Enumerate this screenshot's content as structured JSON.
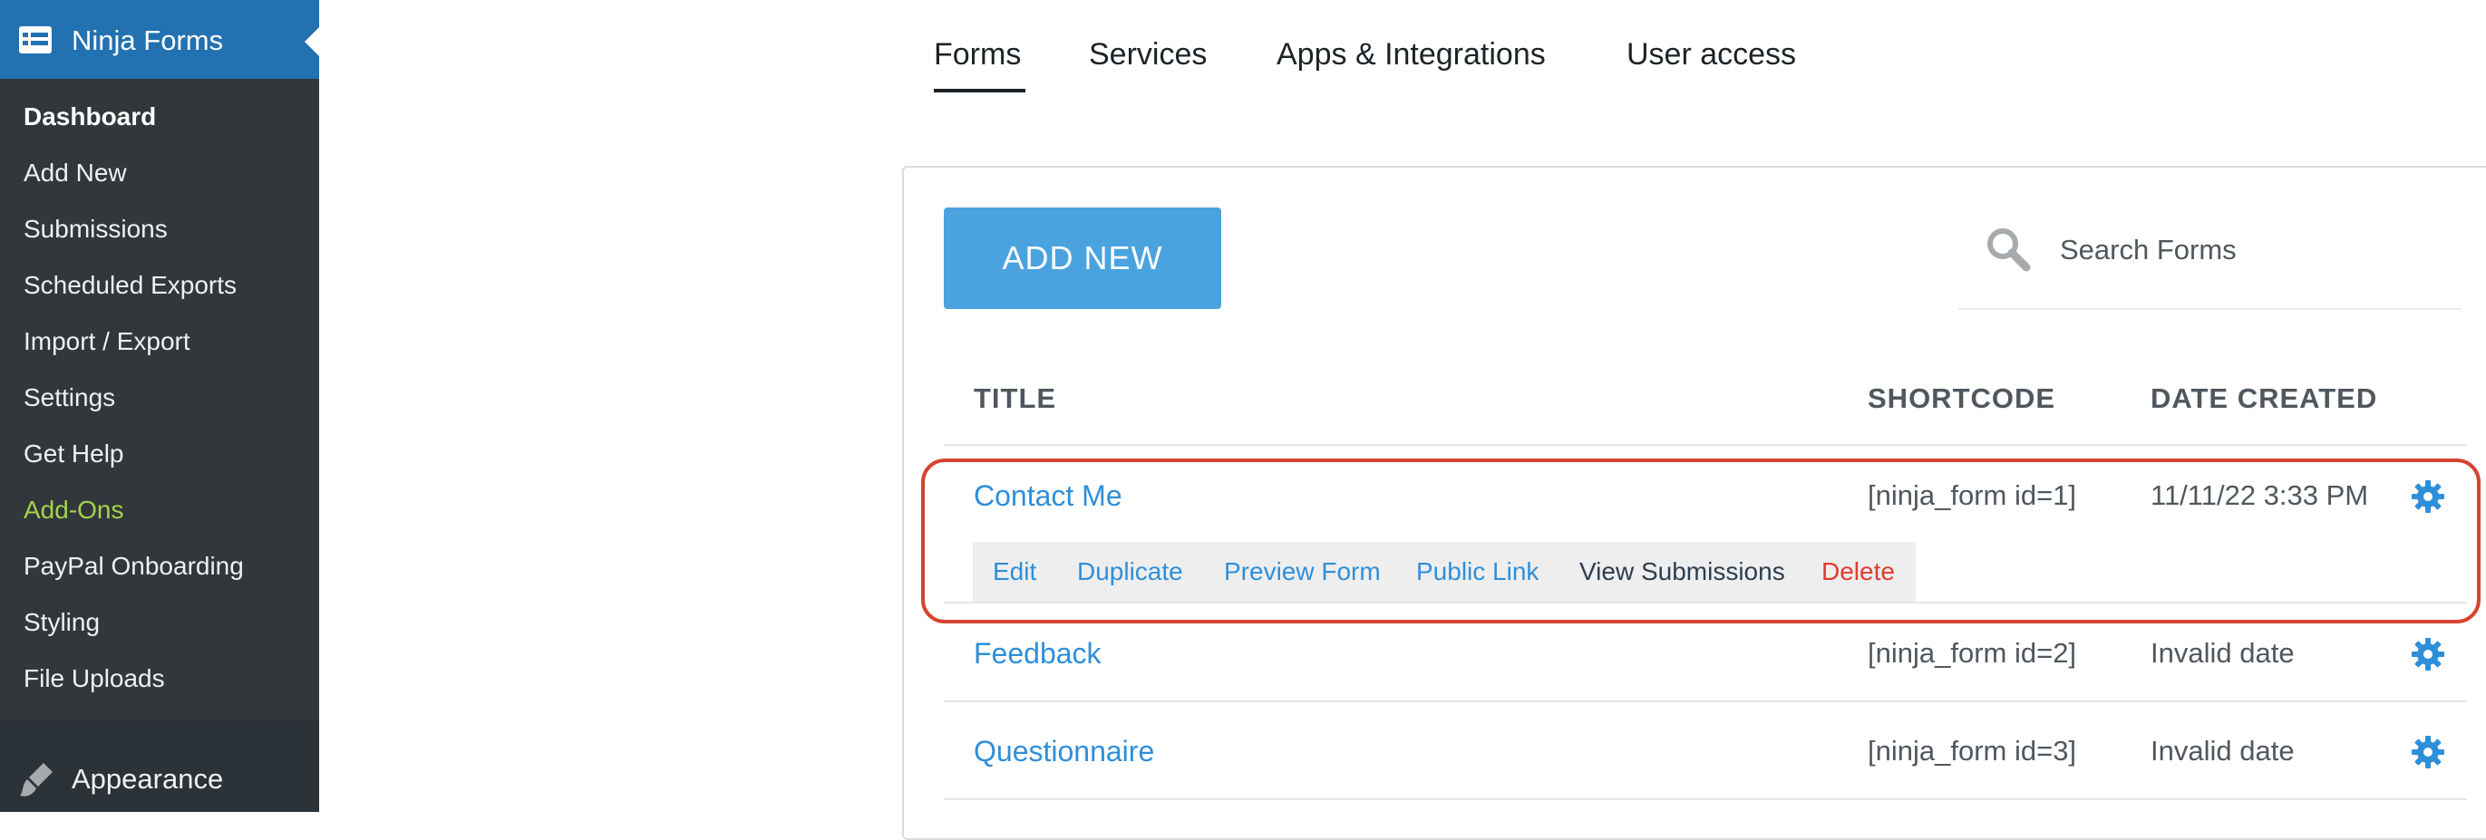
{
  "sidebar": {
    "header_label": "Ninja Forms",
    "header_icon": "ninja-forms-icon",
    "items": [
      {
        "label": "Dashboard",
        "current": true
      },
      {
        "label": "Add New"
      },
      {
        "label": "Submissions"
      },
      {
        "label": "Scheduled Exports"
      },
      {
        "label": "Import / Export"
      },
      {
        "label": "Settings"
      },
      {
        "label": "Get Help"
      },
      {
        "label": "Add-Ons",
        "accent": "#a3d34b"
      },
      {
        "label": "PayPal Onboarding"
      },
      {
        "label": "Styling"
      },
      {
        "label": "File Uploads"
      }
    ],
    "appearance_label": "Appearance",
    "appearance_icon": "paintbrush-icon"
  },
  "tabs": [
    {
      "label": "Forms",
      "active": true
    },
    {
      "label": "Services"
    },
    {
      "label": "Apps & Integrations"
    },
    {
      "label": "User access"
    }
  ],
  "toolbar": {
    "add_new_label": "ADD NEW",
    "search_placeholder": "Search Forms"
  },
  "table": {
    "columns": [
      "TITLE",
      "SHORTCODE",
      "DATE CREATED"
    ],
    "rows": [
      {
        "title": "Contact Me",
        "shortcode": "[ninja_form id=1]",
        "date": "11/11/22 3:33 PM"
      },
      {
        "title": "Feedback",
        "shortcode": "[ninja_form id=2]",
        "date": "Invalid date"
      },
      {
        "title": "Questionnaire",
        "shortcode": "[ninja_form id=3]",
        "date": "Invalid date"
      }
    ],
    "row_actions": [
      "Edit",
      "Duplicate",
      "Preview Form",
      "Public Link",
      "View Submissions",
      "Delete"
    ]
  },
  "colors": {
    "sidebar_bg": "#2c3338",
    "header_accent": "#2271b1",
    "link_blue": "#2e8fd9",
    "button_blue": "#4aa3df",
    "delete_red": "#e33b2e",
    "highlight_red": "#d6432f"
  }
}
